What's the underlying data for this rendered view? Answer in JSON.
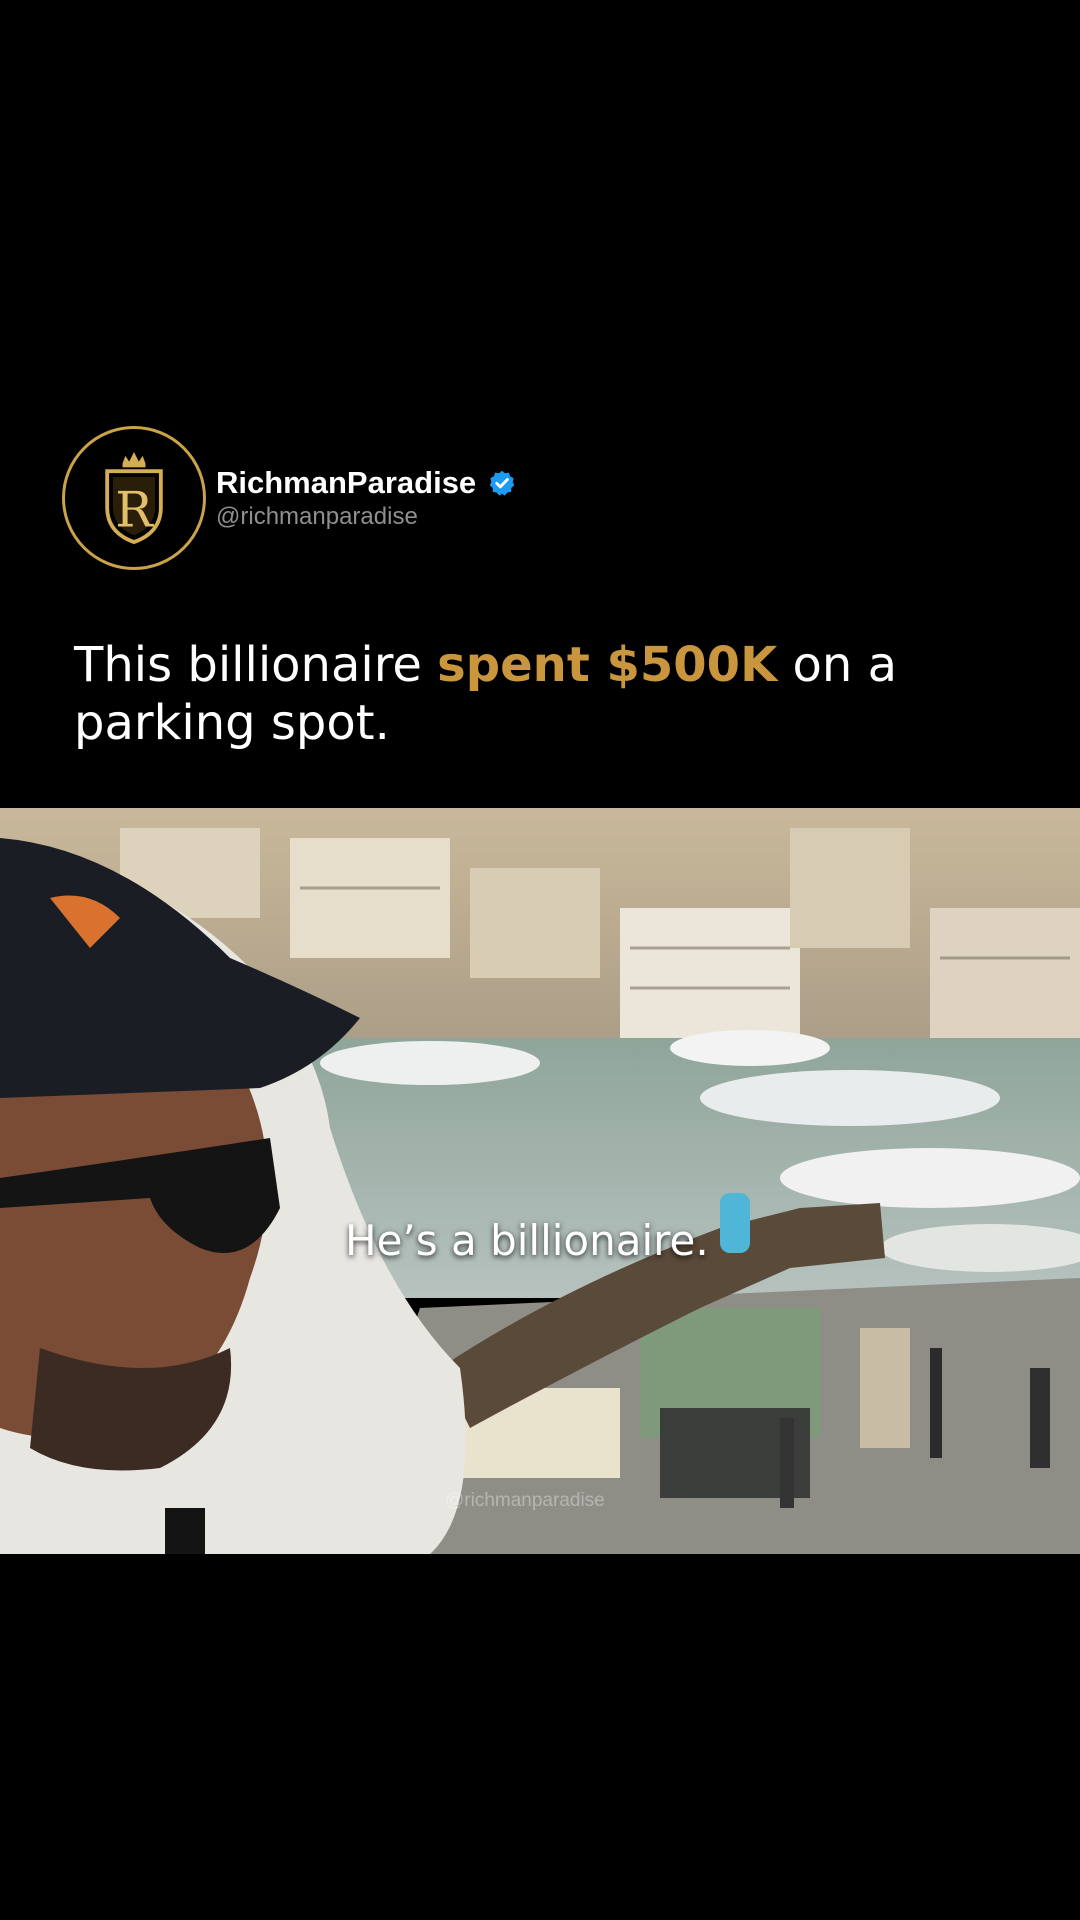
{
  "profile": {
    "display_name": "RichmanParadise",
    "handle": "@richmanparadise",
    "verified": true,
    "avatar_icon": "crowned-R-logo",
    "avatar_monogram": "R"
  },
  "caption": {
    "before": "This billionaire ",
    "highlight": "spent $500K",
    "after": " on a parking spot."
  },
  "video": {
    "subtitle": "He’s a billionaire.",
    "watermark": "@richmanparadise"
  },
  "colors": {
    "accent_gold": "#c9953d",
    "verified_blue": "#1d9bf0",
    "background": "#000000"
  }
}
